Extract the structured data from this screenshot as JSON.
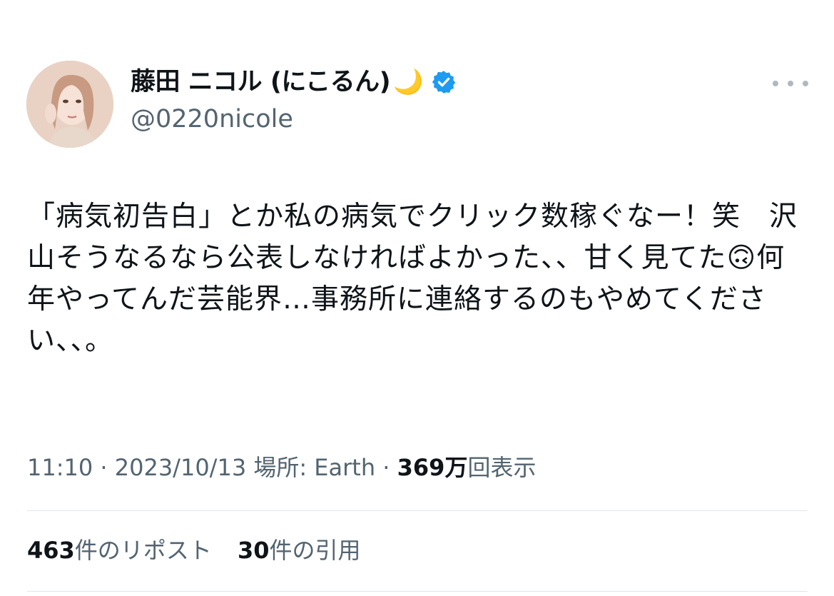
{
  "author": {
    "display_name": "藤田 ニコル (にこるん)",
    "moon_emoji": "🌙",
    "handle": "@0220nicole",
    "verified": true,
    "verified_color": "#1d9bf0"
  },
  "tweet": {
    "text": "「病気初告白」とか私の病気でクリック数稼ぐなー！笑　沢山そうなるなら公表しなければよかった、、甘く見てた🙃何年やってんだ芸能界…事務所に連絡するのもやめてください、、。"
  },
  "meta": {
    "time": "11:10",
    "sep1": " · ",
    "date": "2023/10/13",
    "location_label": " 場所: Earth",
    "sep2": " · ",
    "views_count": "369万",
    "views_label": "回表示"
  },
  "stats": {
    "reposts_count": "463",
    "reposts_label": "件のリポスト",
    "quotes_count": "30",
    "quotes_label": "件の引用"
  },
  "icons": {
    "more": "more-horizontal-icon",
    "verified": "verified-badge-icon",
    "avatar": "profile-photo"
  }
}
